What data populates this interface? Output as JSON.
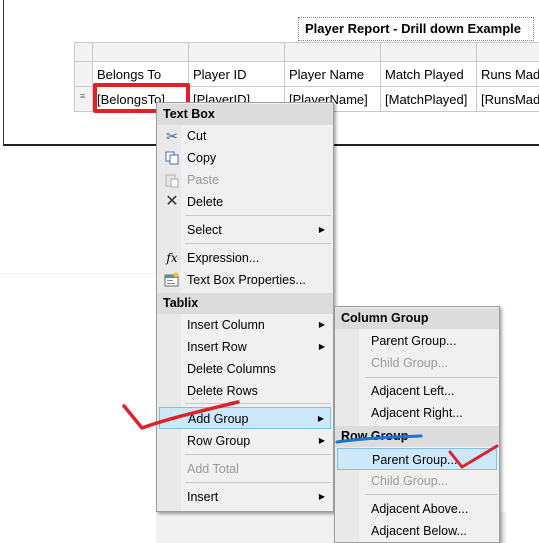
{
  "report": {
    "title": "Player Report - Drill down Example",
    "columns": [
      "Belongs To",
      "Player ID",
      "Player Name",
      "Match Played",
      "Runs Mad"
    ],
    "fields": [
      "[BelongsTo]",
      "[PlayerID]",
      "[PlayerName]",
      "[MatchPlayed]",
      "[RunsMad"
    ]
  },
  "menu": {
    "textbox_header": "Text Box",
    "cut": "Cut",
    "copy": "Copy",
    "paste": "Paste",
    "delete": "Delete",
    "select": "Select",
    "expression": "Expression...",
    "textbox_properties": "Text Box Properties...",
    "tablix_header": "Tablix",
    "insert_column": "Insert Column",
    "insert_row": "Insert Row",
    "delete_columns": "Delete Columns",
    "delete_rows": "Delete Rows",
    "add_group": "Add Group",
    "row_group": "Row Group",
    "add_total": "Add Total",
    "insert": "Insert"
  },
  "submenu": {
    "column_group_header": "Column Group",
    "col_parent_group": "Parent Group...",
    "col_child_group": "Child Group...",
    "adjacent_left": "Adjacent Left...",
    "adjacent_right": "Adjacent Right...",
    "row_group_header": "Row Group",
    "row_parent_group": "Parent Group...",
    "row_child_group": "Child Group...",
    "adjacent_above": "Adjacent Above...",
    "adjacent_below": "Adjacent Below..."
  },
  "icons": {
    "cut": "scissors-icon",
    "copy": "copy-icon",
    "paste": "paste-icon",
    "delete": "x-icon",
    "expression": "fx-icon",
    "properties": "properties-icon"
  },
  "colors": {
    "annotation_red": "#e0202a",
    "annotation_blue": "#1a73d9",
    "highlight": "#cde8fb"
  }
}
